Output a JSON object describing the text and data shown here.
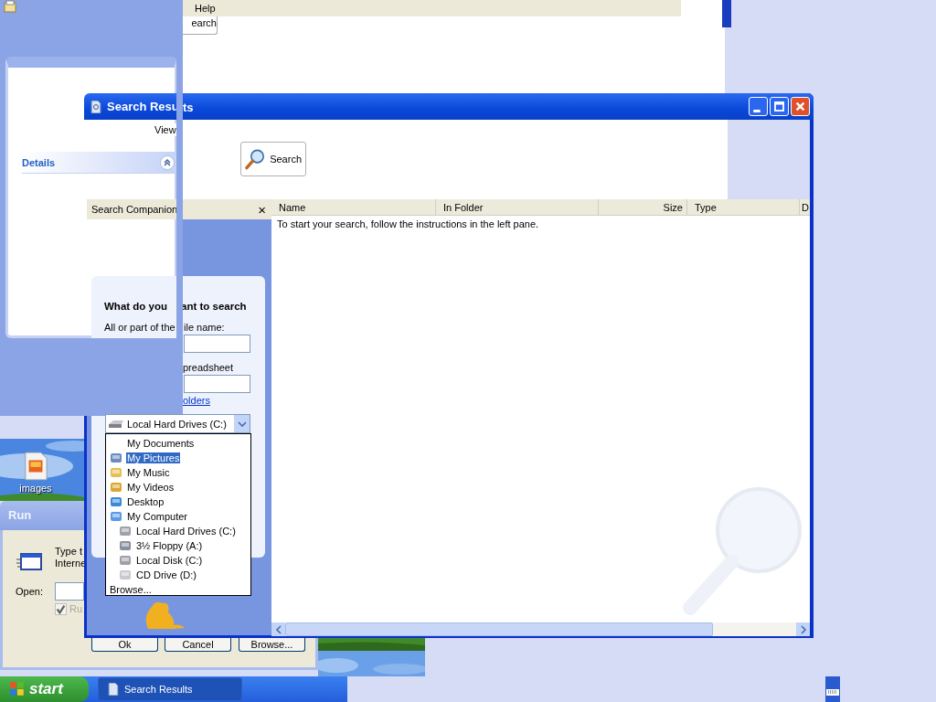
{
  "background_window": {
    "menu": [
      "Help"
    ],
    "button": "earch"
  },
  "side_panel": {
    "section": {
      "title": "Details",
      "expanded": true
    }
  },
  "search_window": {
    "title_parts": [
      "Search Resu",
      "ts"
    ],
    "menu": [
      "View"
    ],
    "toolbar_button": "Search",
    "companion": {
      "title": "Search Companion",
      "close": "×",
      "question_parts": [
        "What do you ",
        "ant to search"
      ],
      "label_parts": [
        "All or part of the",
        "ile name:"
      ],
      "word_label": "preadsheet",
      "folders_link": "olders",
      "look_in": "Local Hard Drives (C:)",
      "dropdown": [
        {
          "label": "My Documents",
          "kind": "none",
          "selected": false
        },
        {
          "label": "My Pictures",
          "kind": "pictures",
          "selected": true
        },
        {
          "label": "My Music",
          "kind": "music",
          "selected": false
        },
        {
          "label": "My Videos",
          "kind": "videos",
          "selected": false
        },
        {
          "label": "Desktop",
          "kind": "desktop",
          "selected": false
        },
        {
          "label": "My Computer",
          "kind": "computer",
          "selected": false,
          "children": [
            {
              "label": "Local Hard Drives (C:)",
              "kind": "harddisk",
              "selected": false
            },
            {
              "label": "3½ Floppy (A:)",
              "kind": "floppy",
              "selected": false
            },
            {
              "label": "Local Disk (C:)",
              "kind": "harddisk",
              "selected": false
            },
            {
              "label": "CD Drive (D:)",
              "kind": "cd",
              "selected": false
            }
          ]
        },
        {
          "label": "Browse...",
          "kind": "browse",
          "selected": false
        }
      ]
    },
    "columns": [
      "Name",
      "In Folder",
      "Size",
      "Type",
      "D"
    ],
    "message": "To start your search, follow the instructions in the left pane."
  },
  "run_dialog": {
    "title": "Run",
    "text_parts": [
      "Type t",
      "Interne"
    ],
    "open_label": "Open:",
    "checkbox": {
      "label": "Ru",
      "checked": true
    },
    "buttons": [
      "Ok",
      "Cancel",
      "Browse..."
    ]
  },
  "desktop_icons": [
    {
      "label": "images"
    }
  ],
  "taskbar": {
    "start": "start",
    "tasks": [
      {
        "label": "Search Results",
        "selected": true
      }
    ]
  }
}
